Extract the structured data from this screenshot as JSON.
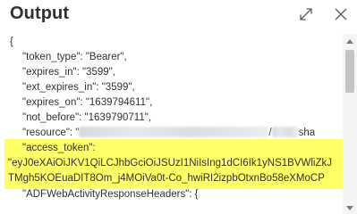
{
  "panel": {
    "title": "Output"
  },
  "icons": {
    "expand": "expand-icon",
    "close": "close-icon"
  },
  "output": {
    "open_brace": "{",
    "token_type_line": "\"token_type\": \"Bearer\",",
    "expires_in_line": "\"expires_in\": \"3599\",",
    "ext_expires_in_line": "\"ext_expires_in\": \"3599\",",
    "expires_on_line": "\"expires_on\": \"1639794611\",",
    "not_before_line": "\"not_before\": \"1639790711\",",
    "resource_key": "\"resource\": \"",
    "resource_tail": "/",
    "resource_tail2": "sha",
    "access_token_key": "\"access_token\":",
    "access_token_line1": "\"eyJ0eXAiOiJKV1QiLCJhbGciOiJSUzI1NiIsIng1dCI6Ik1yNS1BVWliZkJ",
    "access_token_line2": "TMgh5KOEuaDIT8Om_j4MOiVa0t-Co_hwiRI2izpbOtxnBo58eXMoCP",
    "adf_headers_line": "\"ADFWebActivityResponseHeaders\": {"
  },
  "highlight_color": "#ffff66"
}
